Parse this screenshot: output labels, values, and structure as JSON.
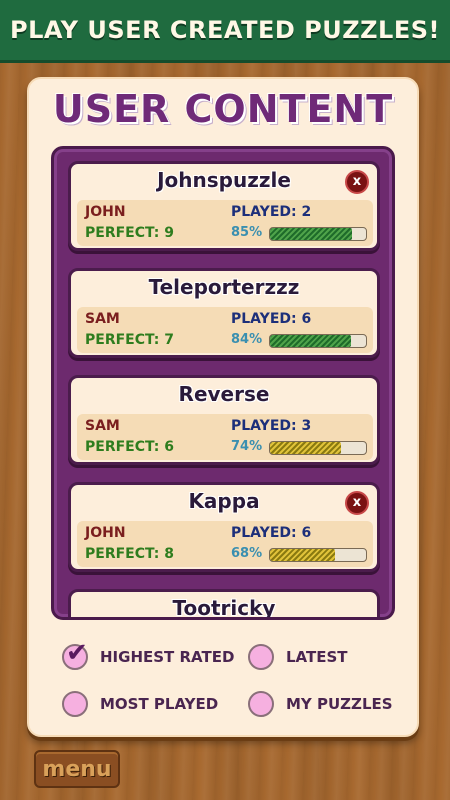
{
  "banner": {
    "text": "PLAY USER CREATED PUZZLES!"
  },
  "panel": {
    "title": "USER CONTENT"
  },
  "puzzles": [
    {
      "name": "Johnspuzzle",
      "author": "JOHN",
      "played": "PLAYED: 2",
      "perfect": "PERFECT: 9",
      "percent": "85%",
      "progress": 0.85,
      "bar_color": "green",
      "deletable": true
    },
    {
      "name": "Teleporterzzz",
      "author": "SAM",
      "played": "PLAYED: 6",
      "perfect": "PERFECT: 7",
      "percent": "84%",
      "progress": 0.84,
      "bar_color": "green",
      "deletable": false
    },
    {
      "name": "Reverse",
      "author": "SAM",
      "played": "PLAYED: 3",
      "perfect": "PERFECT: 6",
      "percent": "74%",
      "progress": 0.74,
      "bar_color": "yellow",
      "deletable": false
    },
    {
      "name": "Kappa",
      "author": "JOHN",
      "played": "PLAYED: 6",
      "perfect": "PERFECT: 8",
      "percent": "68%",
      "progress": 0.68,
      "bar_color": "yellow",
      "deletable": true
    },
    {
      "name": "Tootricky"
    }
  ],
  "close_label": "x",
  "filters": {
    "highest_rated": {
      "label": "HIGHEST RATED",
      "checked": true
    },
    "latest": {
      "label": "LATEST",
      "checked": false
    },
    "most_played": {
      "label": "MOST PLAYED",
      "checked": false
    },
    "my_puzzles": {
      "label": "MY PUZZLES",
      "checked": false
    }
  },
  "check_glyph": "✔",
  "menu": {
    "label": "menu"
  },
  "colors": {
    "banner": "#1f6b3f",
    "panel_title": "#6f2a78",
    "list_frame": "#6d2a6e",
    "radio": "#f6b0e0"
  }
}
